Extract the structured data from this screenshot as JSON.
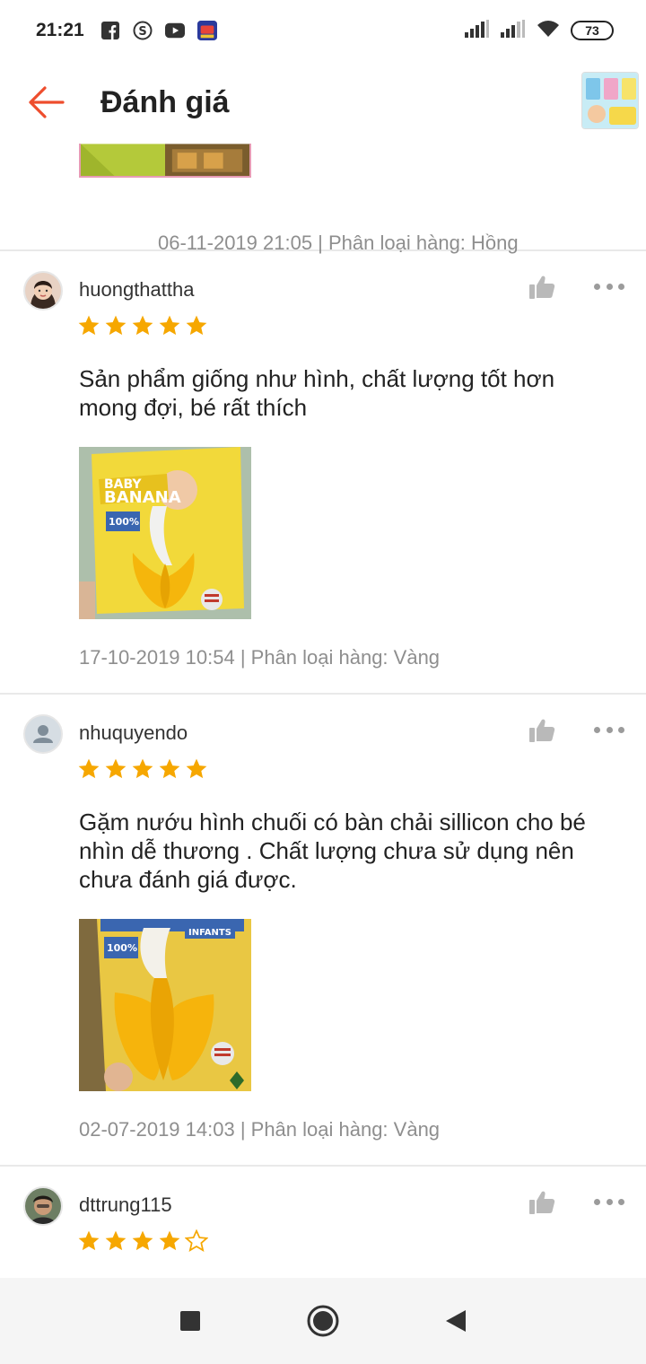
{
  "status_bar": {
    "time": "21:21",
    "battery": "73",
    "icons": [
      "facebook-icon",
      "sticker-icon",
      "youtube-icon",
      "app-icon",
      "signal-icon",
      "signal-icon",
      "wifi-icon",
      "battery-icon"
    ]
  },
  "header": {
    "title": "Đánh giá",
    "back_icon": "arrow-left-icon",
    "accent_color": "#ee4d2d"
  },
  "previous_review": {
    "meta": "06-11-2019 21:05 | Phân loại hàng: Hồng"
  },
  "reviews": [
    {
      "username": "huongthattha",
      "rating": 5,
      "text": "Sản phẩm giống như hình, chất lượng tốt hơn mong đợi, bé rất thích",
      "meta": "17-10-2019 10:54 | Phân loại hàng: Vàng",
      "image_text": {
        "brand_line1": "BABY",
        "brand_line2": "BANANA",
        "badge": "100%"
      }
    },
    {
      "username": "nhuquyendo",
      "rating": 5,
      "text": "Gặm nướu hình chuối có bàn chải sillicon cho bé nhìn dễ thương . Chất lượng chưa sử dụng nên chưa đánh giá được.",
      "meta": "02-07-2019 14:03 | Phân loại hàng: Vàng",
      "image_text": {
        "badge": "100%",
        "tag": "INFANTS"
      }
    },
    {
      "username": "dttrung115",
      "rating": 4
    }
  ],
  "colors": {
    "star": "#f6a700",
    "meta_text": "#8e8e8e",
    "divider": "#e9e9e9"
  }
}
